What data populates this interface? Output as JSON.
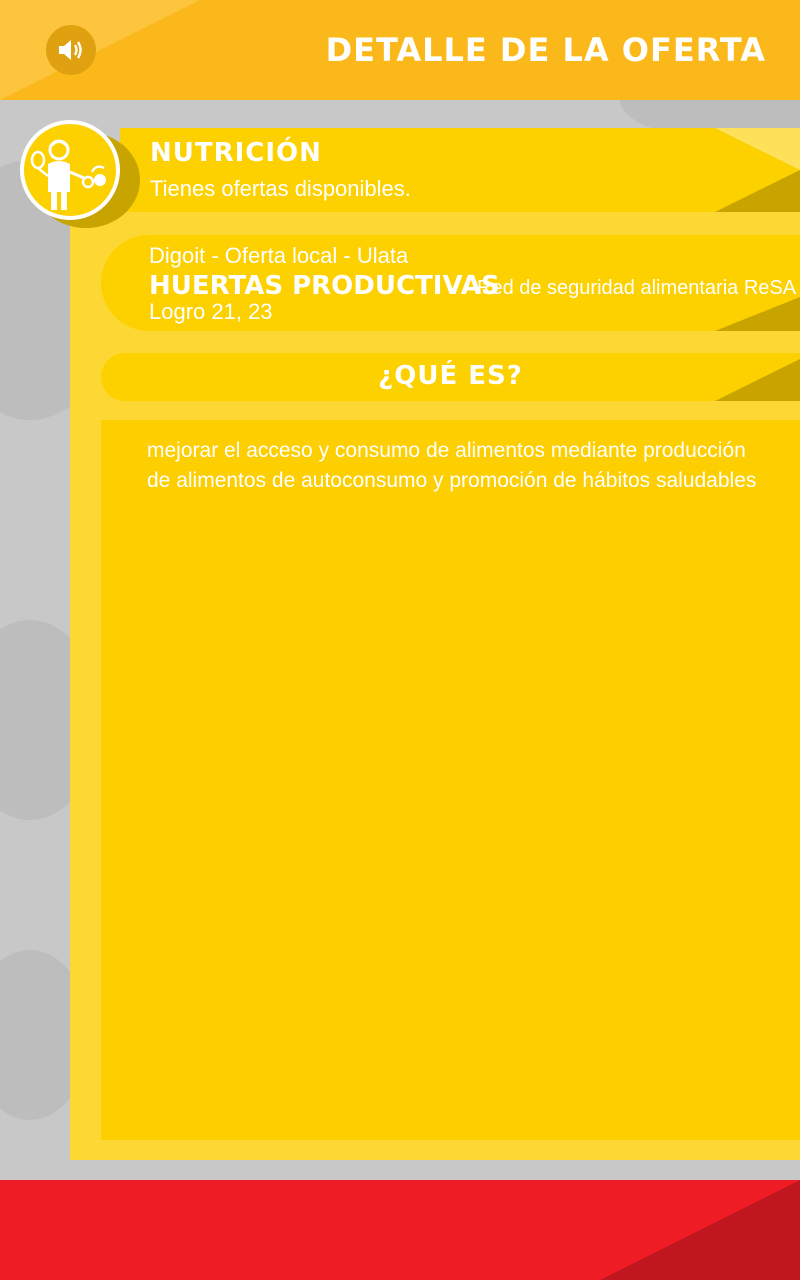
{
  "header": {
    "title": "DETALLE DE LA OFERTA",
    "sound_icon": "speaker-icon"
  },
  "category": {
    "title": "NUTRICIÓN",
    "subtitle": "Tienes  ofertas disponibles.",
    "avatar_icon": "person-with-food-icon"
  },
  "offer": {
    "provider": "Digoit - Oferta local - Ulata",
    "name": "HUERTAS PRODUCTIVAS",
    "program": "Red de seguridad alimentaria ReSA",
    "achievement": "Logro 21, 23"
  },
  "section": {
    "title": "¿QUÉ ES?",
    "description_line1": "mejorar el acceso y consumo de alimentos mediante producción",
    "description_line2": "de alimentos de autoconsumo y promoción de hábitos saludables"
  },
  "colors": {
    "header": "#fbb81a",
    "panel": "#fdd835",
    "card": "#fdd000",
    "footer": "#ee1c25"
  }
}
